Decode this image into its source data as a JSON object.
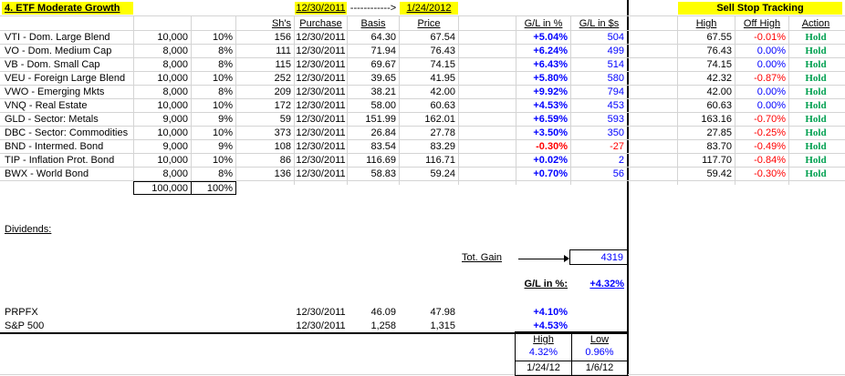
{
  "sheet": {
    "title": "4. ETF Moderate Growth",
    "date_start": "12/30/2011",
    "date_arrow": "------------>",
    "date_end": "1/24/2012",
    "sst_title": "Sell Stop Tracking"
  },
  "headers": {
    "shares": "Sh's",
    "purchase": "Purchase",
    "basis": "Basis",
    "price": "Price",
    "gl_pct": "G/L in %",
    "gl_usd": "G/L in $s",
    "high": "High",
    "off_high": "Off High",
    "action": "Action"
  },
  "holdings": [
    {
      "name": "VTI - Dom. Large Blend",
      "amount": "10,000",
      "pct": "10%",
      "shares": "156",
      "purchase": "12/30/2011",
      "basis": "64.30",
      "price": "67.54",
      "gl_pct": "+5.04%",
      "gl_usd": "504",
      "high": "67.55",
      "off_high": "-0.01%",
      "action": "Hold"
    },
    {
      "name": "VO - Dom. Medium Cap",
      "amount": "8,000",
      "pct": "8%",
      "shares": "111",
      "purchase": "12/30/2011",
      "basis": "71.94",
      "price": "76.43",
      "gl_pct": "+6.24%",
      "gl_usd": "499",
      "high": "76.43",
      "off_high": "0.00%",
      "action": "Hold"
    },
    {
      "name": "VB - Dom. Small Cap",
      "amount": "8,000",
      "pct": "8%",
      "shares": "115",
      "purchase": "12/30/2011",
      "basis": "69.67",
      "price": "74.15",
      "gl_pct": "+6.43%",
      "gl_usd": "514",
      "high": "74.15",
      "off_high": "0.00%",
      "action": "Hold"
    },
    {
      "name": "VEU - Foreign Large Blend",
      "amount": "10,000",
      "pct": "10%",
      "shares": "252",
      "purchase": "12/30/2011",
      "basis": "39.65",
      "price": "41.95",
      "gl_pct": "+5.80%",
      "gl_usd": "580",
      "high": "42.32",
      "off_high": "-0.87%",
      "action": "Hold"
    },
    {
      "name": "VWO - Emerging Mkts",
      "amount": "8,000",
      "pct": "8%",
      "shares": "209",
      "purchase": "12/30/2011",
      "basis": "38.21",
      "price": "42.00",
      "gl_pct": "+9.92%",
      "gl_usd": "794",
      "high": "42.00",
      "off_high": "0.00%",
      "action": "Hold"
    },
    {
      "name": "VNQ - Real Estate",
      "amount": "10,000",
      "pct": "10%",
      "shares": "172",
      "purchase": "12/30/2011",
      "basis": "58.00",
      "price": "60.63",
      "gl_pct": "+4.53%",
      "gl_usd": "453",
      "high": "60.63",
      "off_high": "0.00%",
      "action": "Hold"
    },
    {
      "name": "GLD - Sector: Metals",
      "amount": "9,000",
      "pct": "9%",
      "shares": "59",
      "purchase": "12/30/2011",
      "basis": "151.99",
      "price": "162.01",
      "gl_pct": "+6.59%",
      "gl_usd": "593",
      "high": "163.16",
      "off_high": "-0.70%",
      "action": "Hold"
    },
    {
      "name": "DBC - Sector: Commodities",
      "amount": "10,000",
      "pct": "10%",
      "shares": "373",
      "purchase": "12/30/2011",
      "basis": "26.84",
      "price": "27.78",
      "gl_pct": "+3.50%",
      "gl_usd": "350",
      "high": "27.85",
      "off_high": "-0.25%",
      "action": "Hold"
    },
    {
      "name": "BND - Intermed. Bond",
      "amount": "9,000",
      "pct": "9%",
      "shares": "108",
      "purchase": "12/30/2011",
      "basis": "83.54",
      "price": "83.29",
      "gl_pct": "-0.30%",
      "gl_usd": "-27",
      "high": "83.70",
      "off_high": "-0.49%",
      "action": "Hold"
    },
    {
      "name": "TIP - Inflation Prot. Bond",
      "amount": "10,000",
      "pct": "10%",
      "shares": "86",
      "purchase": "12/30/2011",
      "basis": "116.69",
      "price": "116.71",
      "gl_pct": "+0.02%",
      "gl_usd": "2",
      "high": "117.70",
      "off_high": "-0.84%",
      "action": "Hold"
    },
    {
      "name": "BWX - World Bond",
      "amount": "8,000",
      "pct": "8%",
      "shares": "136",
      "purchase": "12/30/2011",
      "basis": "58.83",
      "price": "59.24",
      "gl_pct": "+0.70%",
      "gl_usd": "56",
      "high": "59.42",
      "off_high": "-0.30%",
      "action": "Hold"
    }
  ],
  "totals": {
    "amount": "100,000",
    "pct": "100%"
  },
  "dividends_label": "Dividends:",
  "tot_gain": {
    "label": "Tot. Gain",
    "arrow": "------------>",
    "value": "4319"
  },
  "gl_pct_total": {
    "label": "G/L in %:",
    "value": "+4.32%"
  },
  "benchmarks": [
    {
      "name": "PRPFX",
      "purchase": "12/30/2011",
      "basis": "46.09",
      "price": "47.98",
      "gl_pct": "+4.10%"
    },
    {
      "name": "S&P 500",
      "purchase": "12/30/2011",
      "basis": "1,258",
      "price": "1,315",
      "gl_pct": "+4.53%"
    }
  ],
  "high_low": {
    "high_label": "High",
    "low_label": "Low",
    "high_value": "4.32%",
    "low_value": "0.96%",
    "high_date": "1/24/12",
    "low_date": "1/6/12"
  }
}
